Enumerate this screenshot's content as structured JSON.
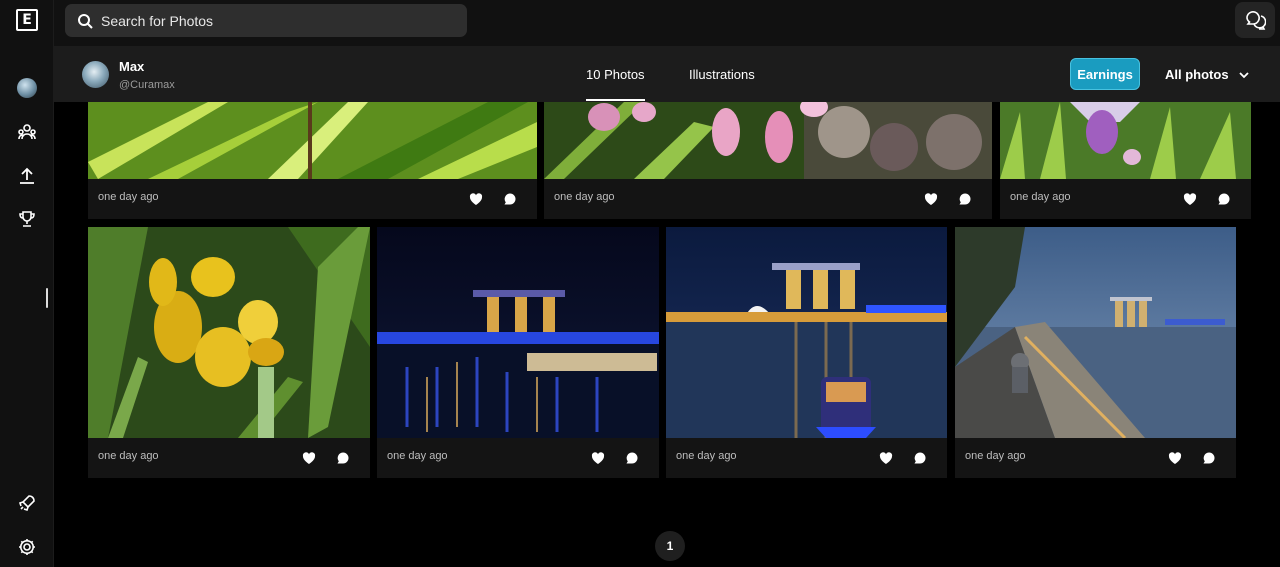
{
  "app": {
    "logo_letter": "E"
  },
  "search": {
    "placeholder": "Search for Photos"
  },
  "profile": {
    "name": "Max",
    "handle": "@Curamax"
  },
  "tabs": [
    {
      "label": "10 Photos",
      "active": true
    },
    {
      "label": "Illustrations",
      "active": false
    }
  ],
  "actions": {
    "earnings_label": "Earnings",
    "filter_label": "All photos"
  },
  "colors": {
    "accent": "#1a9cc0",
    "background": "#000000",
    "card": "#141414",
    "sidebar": "#111111"
  },
  "sidebar_icons": [
    "avatar",
    "community-icon",
    "upload-icon",
    "trophy-icon",
    "rocket-icon",
    "settings-icon"
  ],
  "photos": [
    {
      "subject": "green leaves",
      "timestamp": "one day ago"
    },
    {
      "subject": "pink orchids",
      "timestamp": "one day ago"
    },
    {
      "subject": "purple orchid in grass",
      "timestamp": "one day ago"
    },
    {
      "subject": "yellow orchids",
      "timestamp": "one day ago"
    },
    {
      "subject": "marina bay sands night with blue lights",
      "timestamp": "one day ago"
    },
    {
      "subject": "marina bay sands with boat",
      "timestamp": "one day ago"
    },
    {
      "subject": "waterfront promenade at dusk",
      "timestamp": "one day ago"
    }
  ],
  "pagination": {
    "current_page": "1"
  }
}
